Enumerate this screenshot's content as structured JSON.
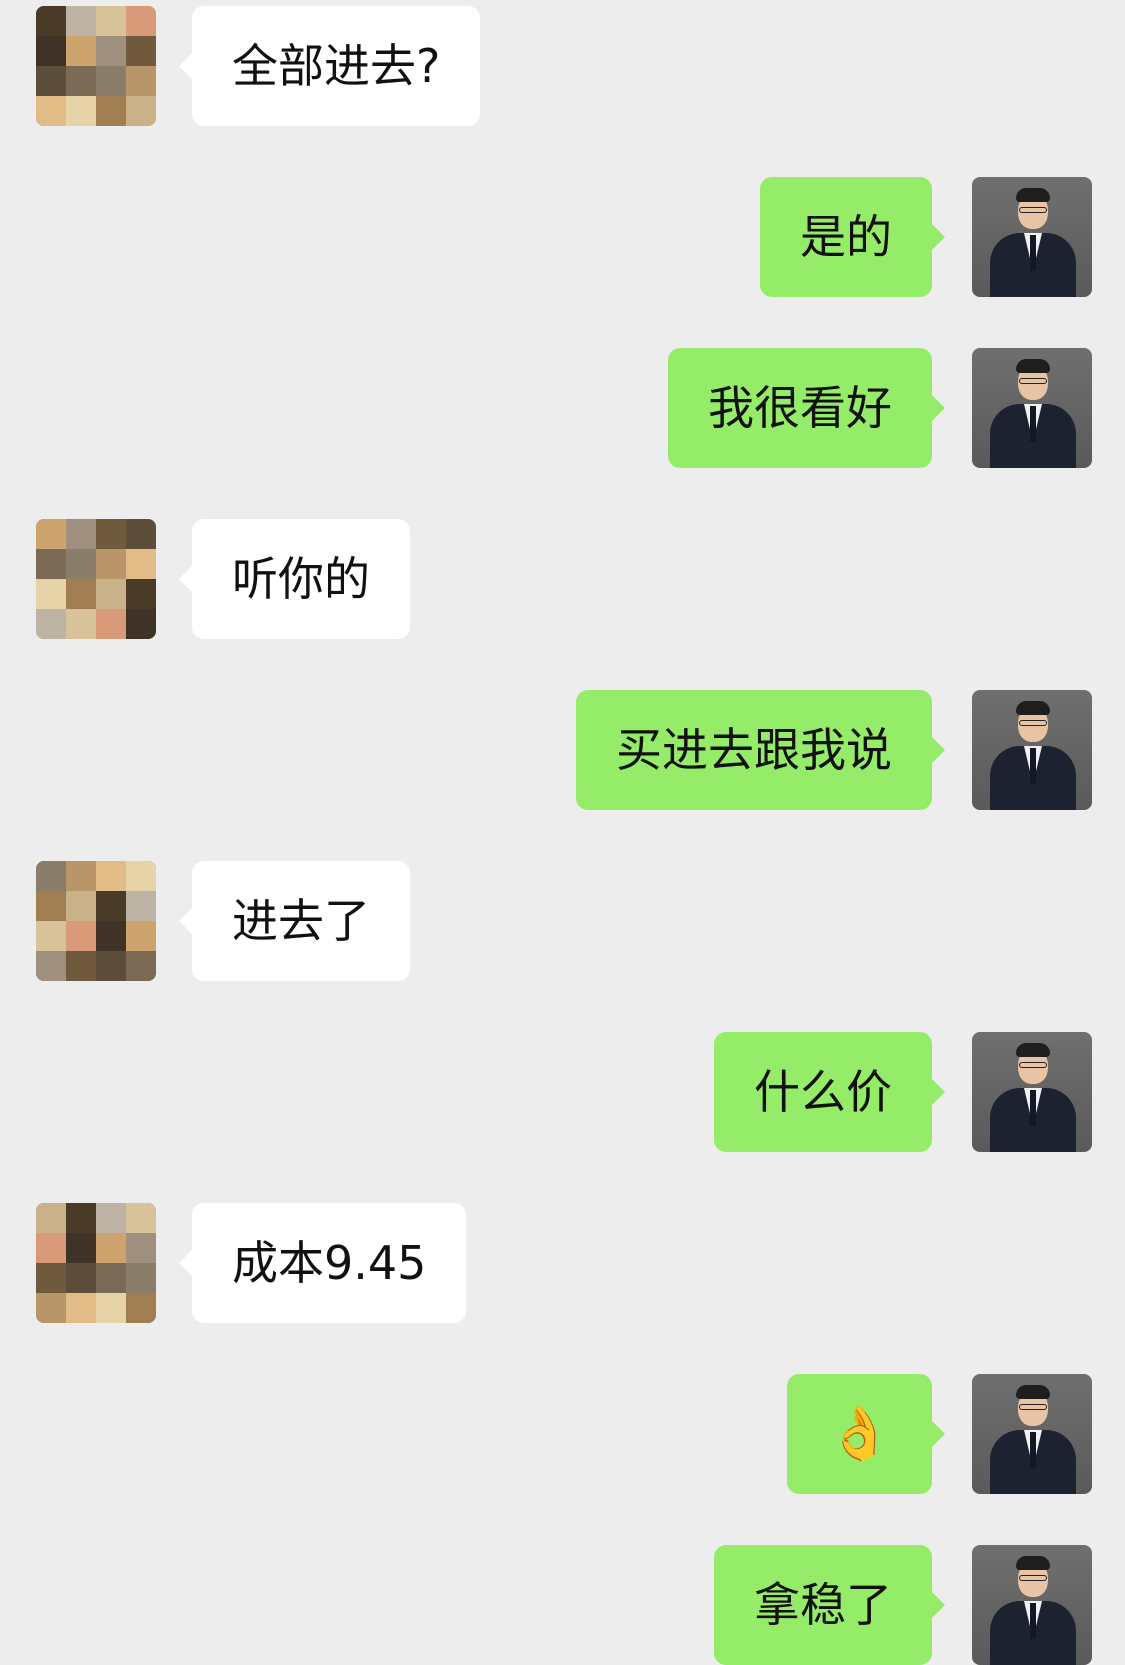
{
  "messages": [
    {
      "side": "left",
      "text": "全部进去?"
    },
    {
      "side": "right",
      "text": "是的"
    },
    {
      "side": "right",
      "text": "我很看好"
    },
    {
      "side": "left",
      "text": "听你的"
    },
    {
      "side": "right",
      "text": "买进去跟我说"
    },
    {
      "side": "left",
      "text": "进去了"
    },
    {
      "side": "right",
      "text": "什么价"
    },
    {
      "side": "left",
      "text": "成本9.45"
    },
    {
      "side": "right",
      "text": "👌"
    },
    {
      "side": "right",
      "text": "拿稳了"
    }
  ],
  "colors": {
    "background": "#ededed",
    "self_bubble": "#95ec69",
    "other_bubble": "#ffffff"
  }
}
